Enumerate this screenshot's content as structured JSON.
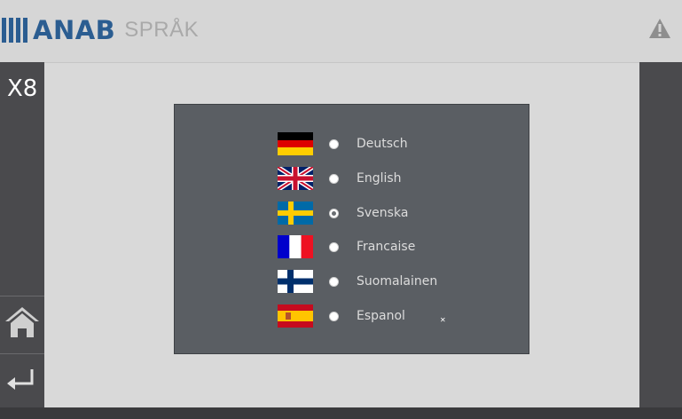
{
  "header": {
    "logo_text": "ANAB",
    "title": "SPRÅK",
    "warning_icon": "warning-triangle-icon"
  },
  "rail": {
    "left_label": "X8",
    "home_icon": "home-icon",
    "back_icon": "return-arrow-icon"
  },
  "languages": [
    {
      "label": "Deutsch",
      "flag": "germany-flag",
      "selected": false
    },
    {
      "label": "English",
      "flag": "uk-flag",
      "selected": false
    },
    {
      "label": "Svenska",
      "flag": "sweden-flag",
      "selected": true
    },
    {
      "label": "Francaise",
      "flag": "france-flag",
      "selected": false
    },
    {
      "label": "Suomalainen",
      "flag": "finland-flag",
      "selected": false
    },
    {
      "label": "Espanol",
      "flag": "spain-flag",
      "selected": false
    }
  ],
  "panel": {
    "close_mark": "✕"
  },
  "colors": {
    "brand": "#2b5d91",
    "rail": "#4a4a4d",
    "panel": "#5a5e63",
    "title_gray": "#a9a9a9"
  }
}
